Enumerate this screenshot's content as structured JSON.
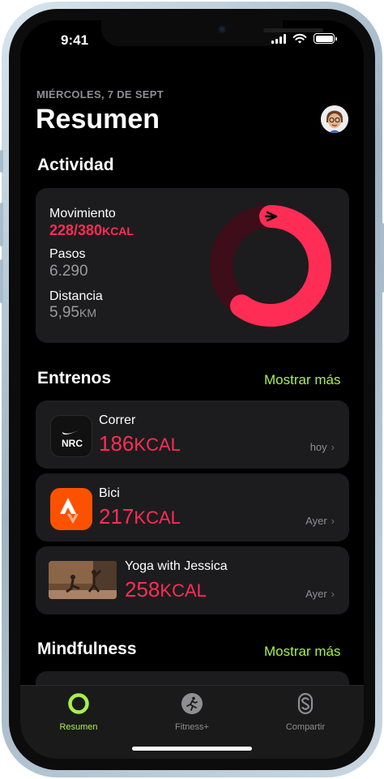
{
  "status": {
    "time": "9:41"
  },
  "header": {
    "date": "MIÉRCOLES, 7 DE SEPT",
    "title": "Resumen"
  },
  "activity": {
    "section_title": "Actividad",
    "move_label": "Movimiento",
    "move_value": "228/380",
    "move_unit": "KCAL",
    "steps_label": "Pasos",
    "steps_value": "6.290",
    "distance_label": "Distancia",
    "distance_value": "5,95",
    "distance_unit": "KM",
    "move_progress": 0.6,
    "ring_color": "#ff2d55"
  },
  "workouts": {
    "section_title": "Entrenos",
    "show_more": "Mostrar más",
    "items": [
      {
        "name": "Correr",
        "kcal": "186",
        "unit": "KCAL",
        "day": "hoy",
        "icon": "nrc-icon"
      },
      {
        "name": "Bici",
        "kcal": "217",
        "unit": "KCAL",
        "day": "Ayer",
        "icon": "strava-icon"
      },
      {
        "name": "Yoga with Jessica",
        "kcal": "258",
        "unit": "KCAL",
        "day": "Ayer",
        "icon": "yoga-thumbnail"
      }
    ]
  },
  "mindfulness": {
    "section_title": "Mindfulness",
    "show_more": "Mostrar más"
  },
  "tabbar": {
    "items": [
      {
        "label": "Resumen",
        "icon": "activity-ring-icon",
        "active": true
      },
      {
        "label": "Fitness+",
        "icon": "runner-icon",
        "active": false
      },
      {
        "label": "Compartir",
        "icon": "share-icon",
        "active": false
      }
    ]
  },
  "colors": {
    "accent_green": "#a7f04a",
    "move_red": "#ff2d55",
    "background": "#000000",
    "card": "#1c1c1e"
  }
}
